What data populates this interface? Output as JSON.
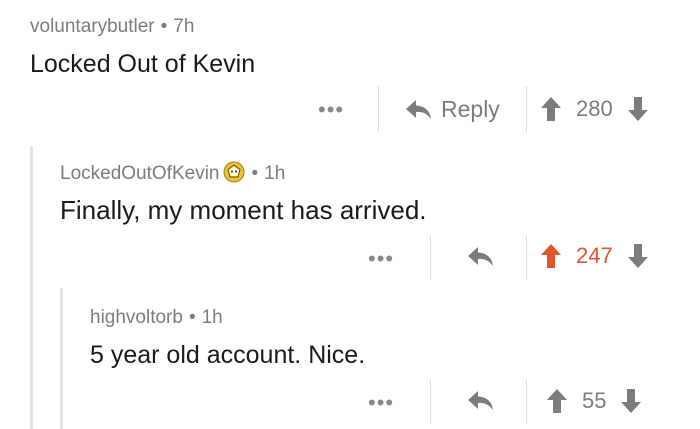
{
  "comments": [
    {
      "author": "voluntarybutler",
      "age": "7h",
      "text": "Locked Out of Kevin",
      "reply_label": "Reply",
      "score": "280",
      "upvoted": false
    },
    {
      "author": "LockedOutOfKevin",
      "age": "1h",
      "text": "Finally, my moment has arrived.",
      "reply_label": "",
      "score": "247",
      "upvoted": true
    },
    {
      "author": "highvoltorb",
      "age": "1h",
      "text": "5 year old account. Nice.",
      "reply_label": "",
      "score": "55",
      "upvoted": false
    }
  ],
  "separator": "•",
  "more_label": "•••",
  "colors": {
    "upvote_active": "#e0562b",
    "icon_gray": "#7c7c7c",
    "badge_gold": "#f2c12e"
  },
  "icons": {
    "reply": "reply-arrow-icon",
    "upvote": "upvote-arrow-icon",
    "downvote": "downvote-arrow-icon",
    "more": "more-dots-icon",
    "badge": "user-badge-icon"
  }
}
